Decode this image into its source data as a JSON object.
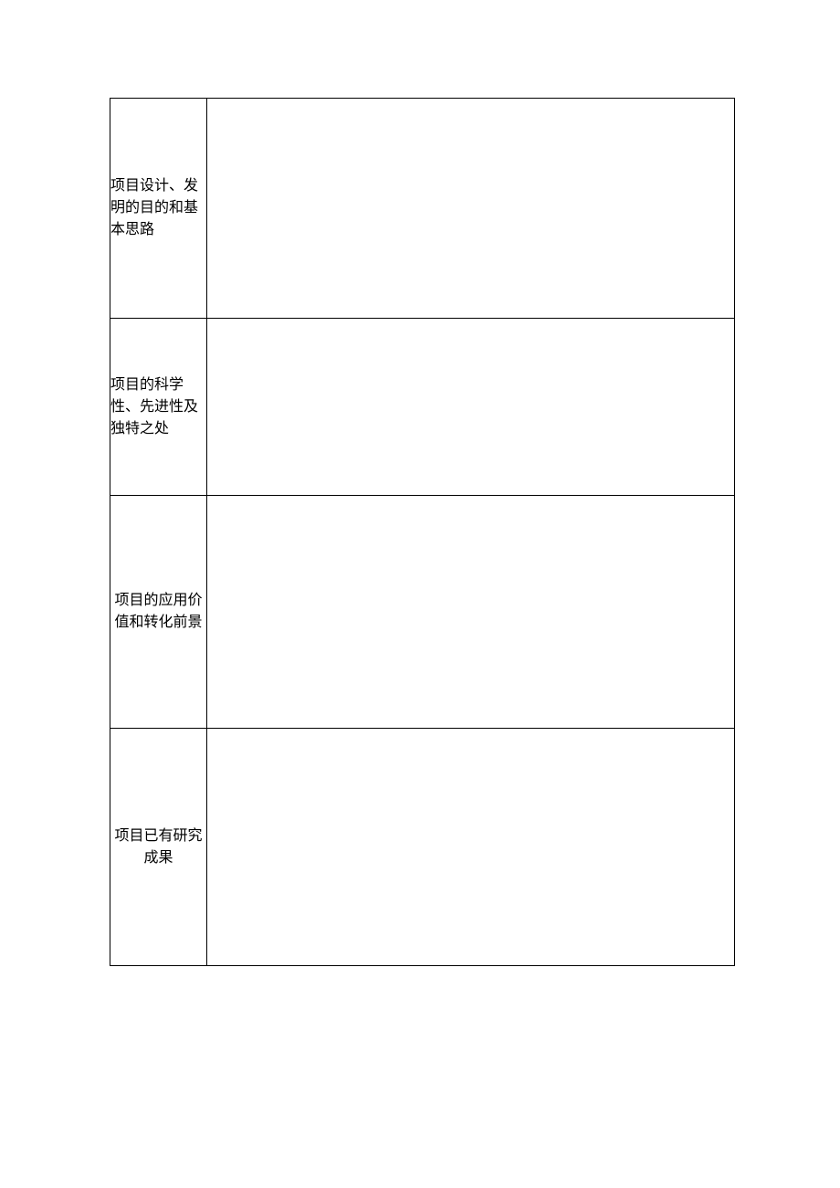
{
  "rows": [
    {
      "label": "项目设计、发明的目的和基本思路",
      "content": ""
    },
    {
      "label": "项目的科学性、先进性及独特之处",
      "content": ""
    },
    {
      "label": "项目的应用价值和转化前景",
      "content": ""
    },
    {
      "label": "项目已有研究成果",
      "content": ""
    }
  ]
}
